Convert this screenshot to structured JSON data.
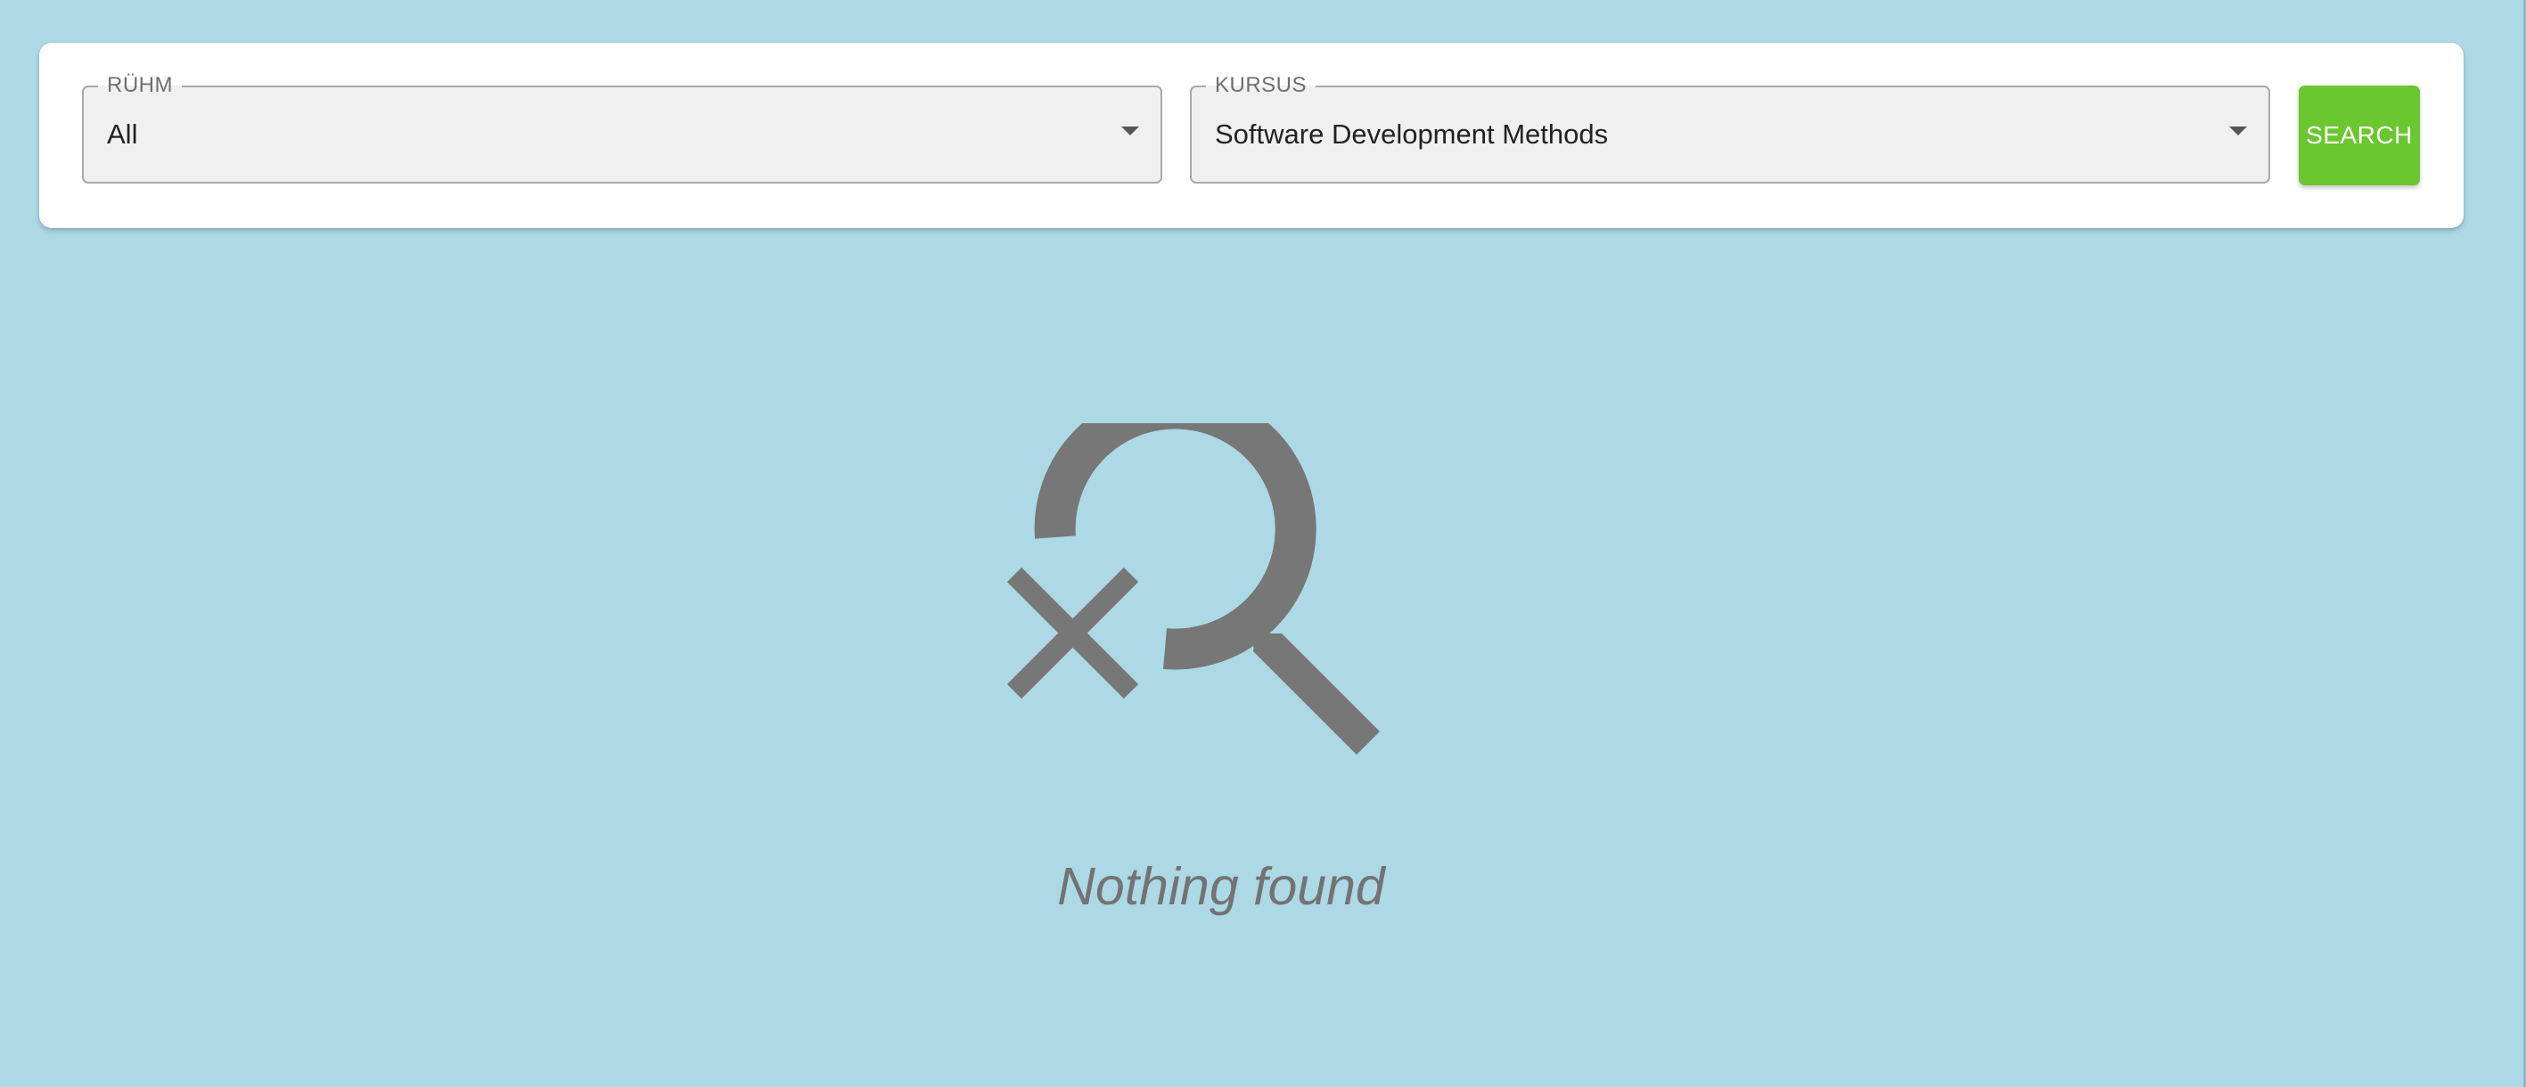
{
  "filters": {
    "group": {
      "label": "RÜHM",
      "value": "All"
    },
    "course": {
      "label": "KURSUS",
      "value": "Software Development Methods"
    },
    "search_button_label": "SEARCH"
  },
  "empty_state": {
    "icon": "search-off-icon",
    "message": "Nothing found"
  },
  "colors": {
    "page_background": "#add8e6",
    "card_background": "#ffffff",
    "field_background": "#f0f0f0",
    "search_button": "#6ac72f",
    "icon_gray": "#777777",
    "message_gray": "#737373"
  }
}
